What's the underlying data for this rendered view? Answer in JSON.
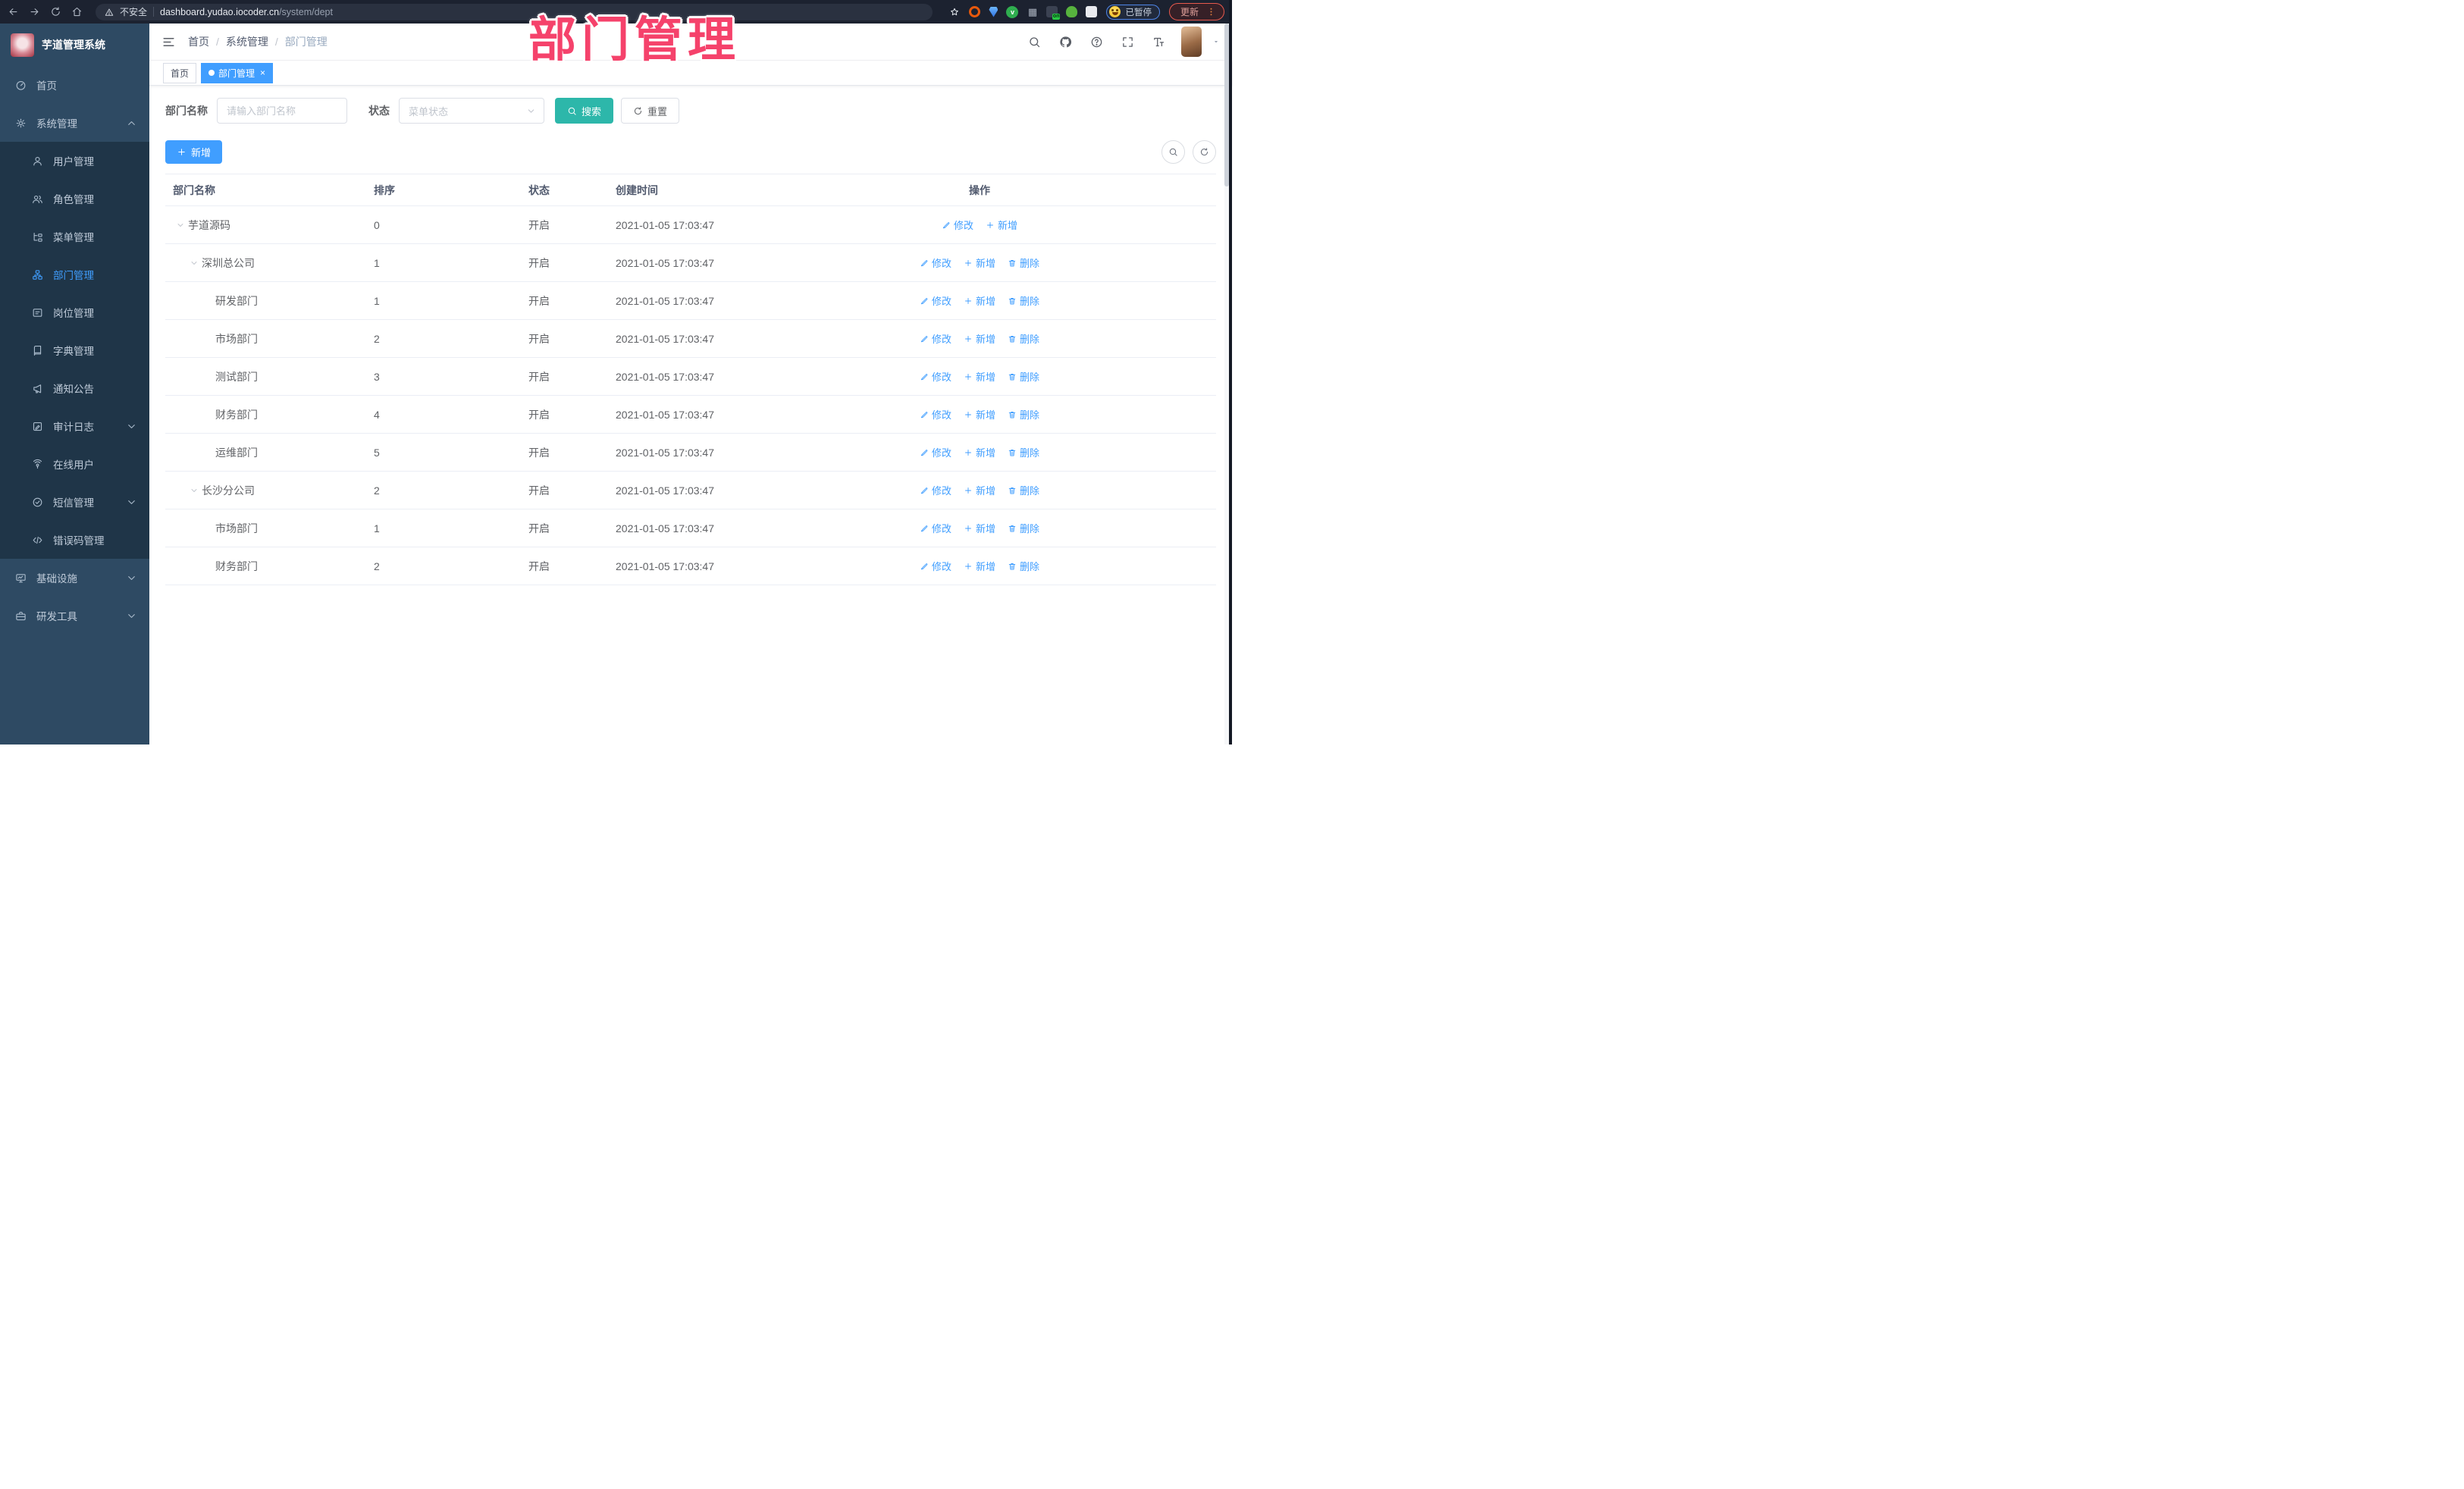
{
  "annotation": {
    "title": "部门管理",
    "color": "#f5426b"
  },
  "browser": {
    "security_label": "不安全",
    "url_host": "dashboard.yudao.iocoder.cn",
    "url_path": "/system/dept",
    "paused_label": "已暂停",
    "update_label": "更新",
    "extensions": [
      "orange-ring-extension",
      "blue-gem-extension",
      "green-check-extension",
      "grid-extension",
      "on-badge-extension",
      "green-bot-extension",
      "puzzle-extension"
    ]
  },
  "sidebar": {
    "app_title": "芋道管理系统",
    "items": [
      {
        "label": "首页",
        "icon": "dashboard",
        "level": "top",
        "caret": ""
      },
      {
        "label": "系统管理",
        "icon": "gear",
        "level": "top",
        "caret": "up"
      },
      {
        "label": "用户管理",
        "icon": "user",
        "level": "sub",
        "caret": ""
      },
      {
        "label": "角色管理",
        "icon": "users",
        "level": "sub",
        "caret": ""
      },
      {
        "label": "菜单管理",
        "icon": "menutree",
        "level": "sub",
        "caret": ""
      },
      {
        "label": "部门管理",
        "icon": "dept",
        "level": "sub",
        "caret": "",
        "active": true
      },
      {
        "label": "岗位管理",
        "icon": "post",
        "level": "sub",
        "caret": ""
      },
      {
        "label": "字典管理",
        "icon": "dict",
        "level": "sub",
        "caret": ""
      },
      {
        "label": "通知公告",
        "icon": "notice",
        "level": "sub",
        "caret": ""
      },
      {
        "label": "审计日志",
        "icon": "audit",
        "level": "sub",
        "caret": "down"
      },
      {
        "label": "在线用户",
        "icon": "online",
        "level": "sub",
        "caret": ""
      },
      {
        "label": "短信管理",
        "icon": "sms",
        "level": "sub",
        "caret": "down"
      },
      {
        "label": "错误码管理",
        "icon": "code",
        "level": "sub",
        "caret": ""
      },
      {
        "label": "基础设施",
        "icon": "infra",
        "level": "top",
        "caret": "down"
      },
      {
        "label": "研发工具",
        "icon": "tools",
        "level": "top",
        "caret": "down"
      }
    ]
  },
  "navbar": {
    "breadcrumb": [
      "首页",
      "系统管理",
      "部门管理"
    ]
  },
  "tags": [
    {
      "label": "首页",
      "active": false
    },
    {
      "label": "部门管理",
      "active": true
    }
  ],
  "filter": {
    "name_label": "部门名称",
    "name_placeholder": "请输入部门名称",
    "status_label": "状态",
    "status_placeholder": "菜单状态",
    "search_label": "搜索",
    "reset_label": "重置"
  },
  "toolbar": {
    "add_label": "新增"
  },
  "table": {
    "columns": [
      "部门名称",
      "排序",
      "状态",
      "创建时间",
      "操作"
    ],
    "op_defs": {
      "modify": {
        "label": "修改",
        "icon": "edit"
      },
      "add": {
        "label": "新增",
        "icon": "plus"
      },
      "delete": {
        "label": "删除",
        "icon": "trash"
      }
    },
    "rows": [
      {
        "name": "芋道源码",
        "level": 0,
        "expanded": true,
        "sort": "0",
        "status": "开启",
        "created": "2021-01-05 17:03:47",
        "ops": [
          "modify",
          "add"
        ]
      },
      {
        "name": "深圳总公司",
        "level": 1,
        "expanded": true,
        "sort": "1",
        "status": "开启",
        "created": "2021-01-05 17:03:47",
        "ops": [
          "modify",
          "add",
          "delete"
        ]
      },
      {
        "name": "研发部门",
        "level": 2,
        "expanded": false,
        "sort": "1",
        "status": "开启",
        "created": "2021-01-05 17:03:47",
        "ops": [
          "modify",
          "add",
          "delete"
        ]
      },
      {
        "name": "市场部门",
        "level": 2,
        "expanded": false,
        "sort": "2",
        "status": "开启",
        "created": "2021-01-05 17:03:47",
        "ops": [
          "modify",
          "add",
          "delete"
        ]
      },
      {
        "name": "测试部门",
        "level": 2,
        "expanded": false,
        "sort": "3",
        "status": "开启",
        "created": "2021-01-05 17:03:47",
        "ops": [
          "modify",
          "add",
          "delete"
        ]
      },
      {
        "name": "财务部门",
        "level": 2,
        "expanded": false,
        "sort": "4",
        "status": "开启",
        "created": "2021-01-05 17:03:47",
        "ops": [
          "modify",
          "add",
          "delete"
        ]
      },
      {
        "name": "运维部门",
        "level": 2,
        "expanded": false,
        "sort": "5",
        "status": "开启",
        "created": "2021-01-05 17:03:47",
        "ops": [
          "modify",
          "add",
          "delete"
        ]
      },
      {
        "name": "长沙分公司",
        "level": 1,
        "expanded": true,
        "sort": "2",
        "status": "开启",
        "created": "2021-01-05 17:03:47",
        "ops": [
          "modify",
          "add",
          "delete"
        ]
      },
      {
        "name": "市场部门",
        "level": 2,
        "expanded": false,
        "sort": "1",
        "status": "开启",
        "created": "2021-01-05 17:03:47",
        "ops": [
          "modify",
          "add",
          "delete"
        ]
      },
      {
        "name": "财务部门",
        "level": 2,
        "expanded": false,
        "sort": "2",
        "status": "开启",
        "created": "2021-01-05 17:03:47",
        "ops": [
          "modify",
          "add",
          "delete"
        ]
      }
    ]
  }
}
